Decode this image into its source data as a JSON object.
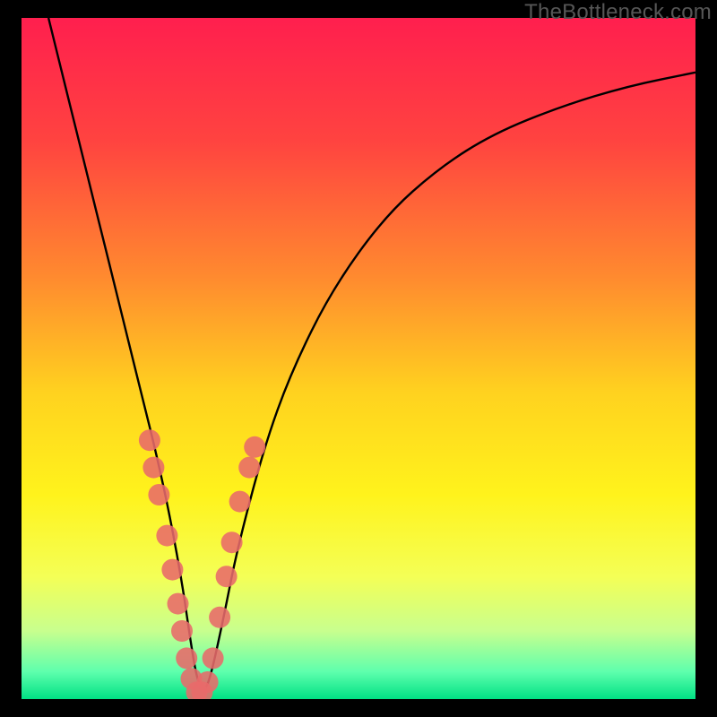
{
  "watermark": "TheBottleneck.com",
  "chart_data": {
    "type": "line",
    "title": "",
    "xlabel": "",
    "ylabel": "",
    "xlim": [
      0,
      100
    ],
    "ylim": [
      0,
      100
    ],
    "grid": false,
    "background": {
      "type": "vertical-gradient",
      "stops": [
        {
          "pct": 0,
          "color": "#ff1f4e"
        },
        {
          "pct": 18,
          "color": "#ff4340"
        },
        {
          "pct": 38,
          "color": "#ff8a2f"
        },
        {
          "pct": 55,
          "color": "#ffd21f"
        },
        {
          "pct": 70,
          "color": "#fff31c"
        },
        {
          "pct": 82,
          "color": "#f4ff56"
        },
        {
          "pct": 90,
          "color": "#c8ff8e"
        },
        {
          "pct": 96,
          "color": "#5effad"
        },
        {
          "pct": 100,
          "color": "#00e184"
        }
      ]
    },
    "series": [
      {
        "name": "bottleneck-curve",
        "color": "#000000",
        "x": [
          4,
          6,
          8,
          10,
          12,
          14,
          16,
          18,
          20,
          22,
          24,
          25,
          26,
          27,
          28,
          30,
          32,
          36,
          40,
          46,
          54,
          62,
          70,
          80,
          90,
          100
        ],
        "y": [
          100,
          92,
          84,
          76,
          68,
          60,
          52,
          44,
          36,
          27,
          16,
          9,
          3,
          1,
          3,
          12,
          22,
          37,
          48,
          60,
          71,
          78,
          83,
          87,
          90,
          92
        ]
      }
    ],
    "markers": {
      "name": "highlighted-points",
      "color": "#e86a6a",
      "radius": 12,
      "points": [
        {
          "x": 19.0,
          "y": 38
        },
        {
          "x": 19.6,
          "y": 34
        },
        {
          "x": 20.4,
          "y": 30
        },
        {
          "x": 21.6,
          "y": 24
        },
        {
          "x": 22.4,
          "y": 19
        },
        {
          "x": 23.2,
          "y": 14
        },
        {
          "x": 23.8,
          "y": 10
        },
        {
          "x": 24.5,
          "y": 6
        },
        {
          "x": 25.2,
          "y": 3
        },
        {
          "x": 26.0,
          "y": 1
        },
        {
          "x": 26.8,
          "y": 1
        },
        {
          "x": 27.6,
          "y": 2.5
        },
        {
          "x": 28.4,
          "y": 6
        },
        {
          "x": 29.4,
          "y": 12
        },
        {
          "x": 30.4,
          "y": 18
        },
        {
          "x": 31.2,
          "y": 23
        },
        {
          "x": 32.4,
          "y": 29
        },
        {
          "x": 33.8,
          "y": 34
        },
        {
          "x": 34.6,
          "y": 37
        }
      ]
    }
  }
}
